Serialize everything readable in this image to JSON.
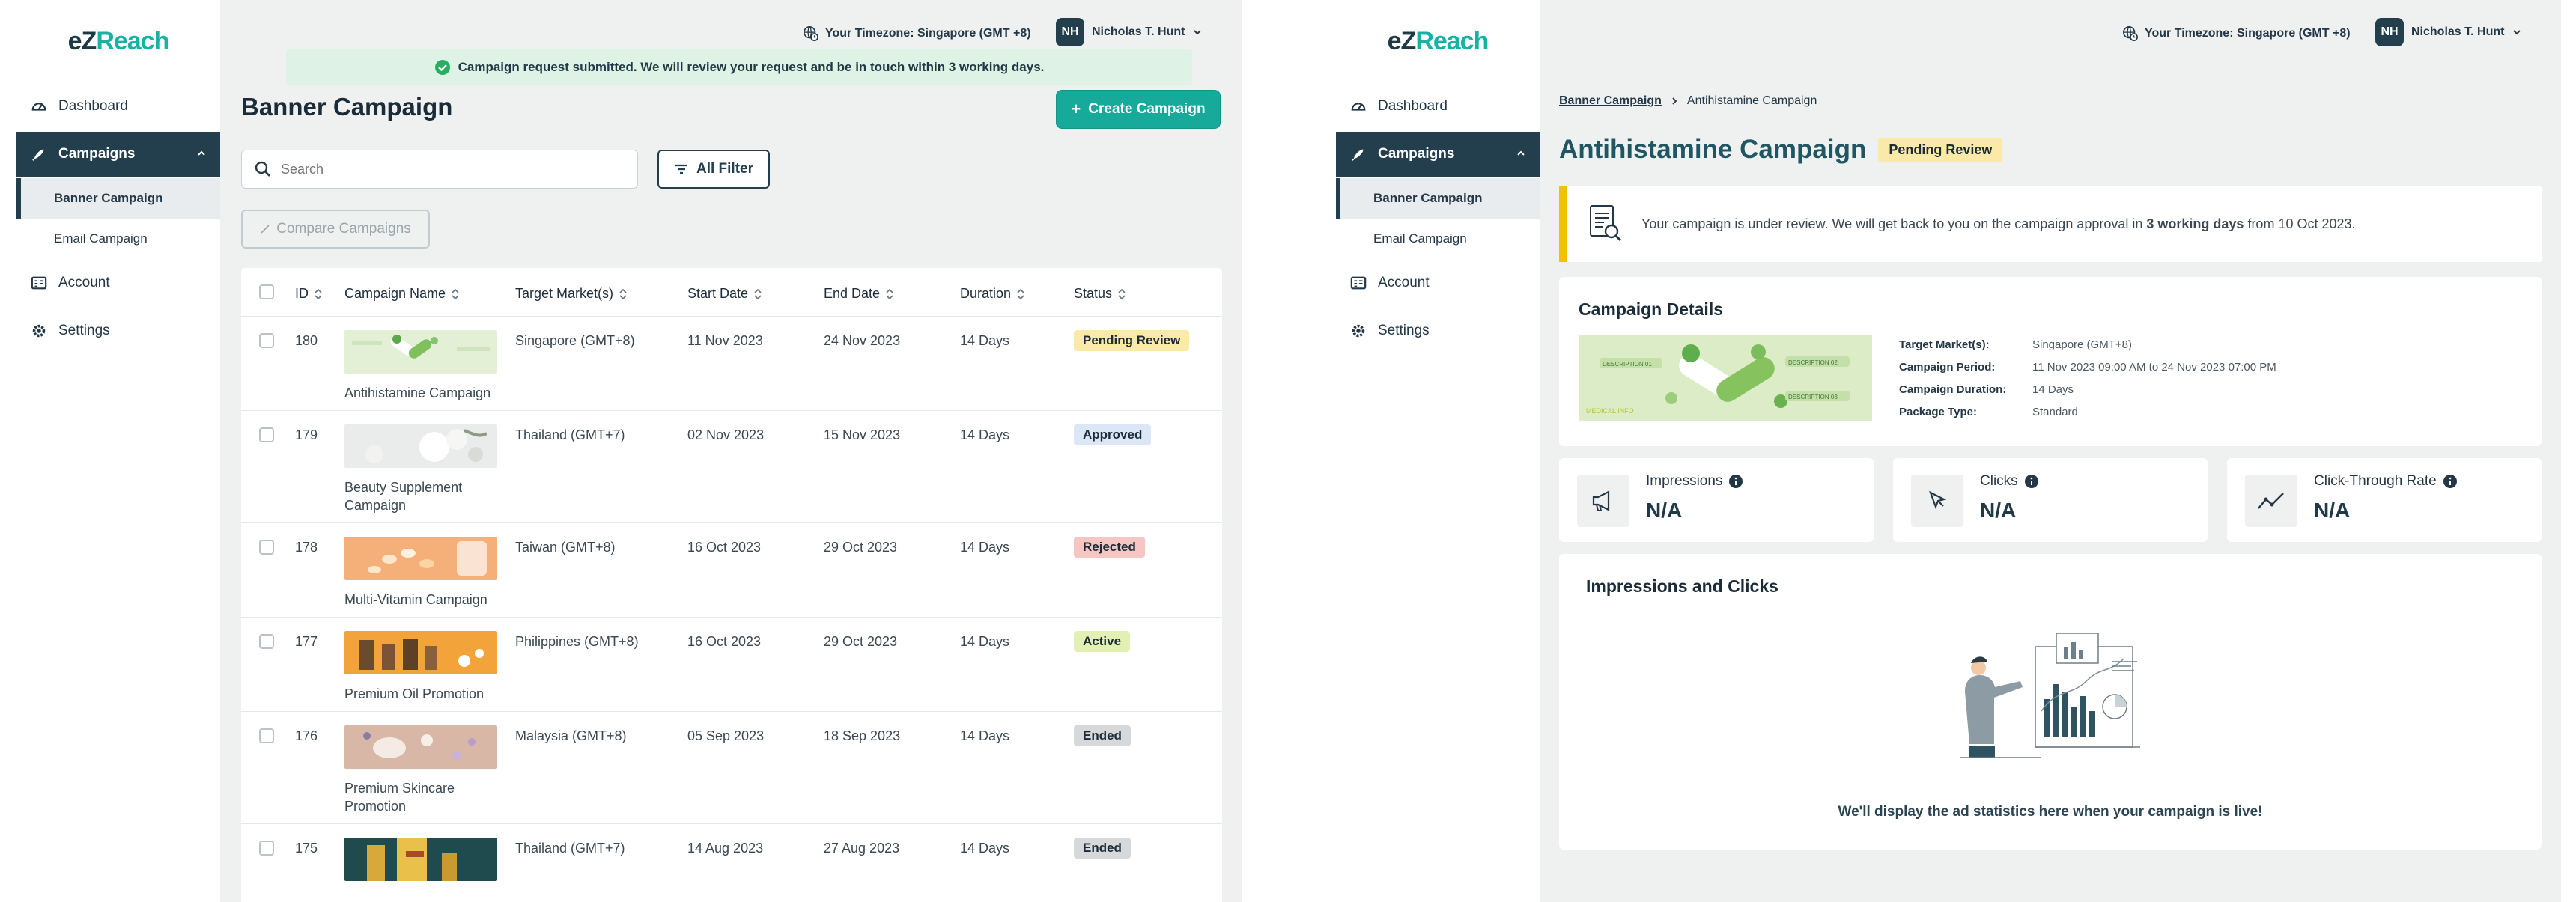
{
  "brand": {
    "logo_part1": "eZ",
    "logo_part2": "Reach"
  },
  "topbar": {
    "timezone": "Your Timezone: Singapore (GMT +8)",
    "user_initials": "NH",
    "user_name": "Nicholas T. Hunt"
  },
  "sidebar": {
    "items": [
      {
        "label": "Dashboard",
        "icon": "dashboard-icon"
      },
      {
        "label": "Campaigns",
        "icon": "rocket-icon"
      },
      {
        "label": "Account",
        "icon": "account-icon"
      },
      {
        "label": "Settings",
        "icon": "gear-icon"
      }
    ],
    "sub_items": [
      {
        "label": "Banner Campaign"
      },
      {
        "label": "Email Campaign"
      }
    ]
  },
  "list_page": {
    "toast": "Campaign request submitted. We will review your request and be in touch within 3 working days.",
    "title": "Banner Campaign",
    "create_button": "Create Campaign",
    "search_placeholder": "Search",
    "filter_button": "All Filter",
    "compare_button": "Compare Campaigns",
    "columns": [
      "ID",
      "Campaign Name",
      "Target Market(s)",
      "Start Date",
      "End Date",
      "Duration",
      "Status"
    ],
    "rows": [
      {
        "id": "180",
        "name": "Antihistamine Campaign",
        "market": "Singapore (GMT+8)",
        "start": "11 Nov 2023",
        "end": "24 Nov 2023",
        "duration": "14 Days",
        "status": "Pending Review",
        "status_color": "#fbe9a8"
      },
      {
        "id": "179",
        "name": "Beauty Supplement Campaign",
        "market": "Thailand (GMT+7)",
        "start": "02 Nov 2023",
        "end": "15 Nov 2023",
        "duration": "14 Days",
        "status": "Approved",
        "status_color": "#dbe6f6"
      },
      {
        "id": "178",
        "name": "Multi-Vitamin Campaign",
        "market": "Taiwan (GMT+8)",
        "start": "16 Oct 2023",
        "end": "29 Oct 2023",
        "duration": "14 Days",
        "status": "Rejected",
        "status_color": "#f6c6c2"
      },
      {
        "id": "177",
        "name": "Premium Oil Promotion",
        "market": "Philippines (GMT+8)",
        "start": "16 Oct 2023",
        "end": "29 Oct 2023",
        "duration": "14 Days",
        "status": "Active",
        "status_color": "#e3f0b4"
      },
      {
        "id": "176",
        "name": "Premium Skincare Promotion",
        "market": "Malaysia (GMT+8)",
        "start": "05 Sep 2023",
        "end": "18 Sep 2023",
        "duration": "14 Days",
        "status": "Ended",
        "status_color": "#d6d8da"
      },
      {
        "id": "175",
        "name": "",
        "market": "Thailand (GMT+7)",
        "start": "14 Aug 2023",
        "end": "27 Aug 2023",
        "duration": "14 Days",
        "status": "Ended",
        "status_color": "#d6d8da"
      }
    ]
  },
  "detail_page": {
    "breadcrumb_root": "Banner Campaign",
    "breadcrumb_current": "Antihistamine Campaign",
    "title": "Antihistamine Campaign",
    "status": "Pending Review",
    "notice_pre": "Your campaign is under review. We will get back to you on the campaign approval in ",
    "notice_bold": "3 working days",
    "notice_post": " from 10 Oct 2023.",
    "details_title": "Campaign Details",
    "banner_text_1": "DESCRIPTION 01",
    "banner_text_2": "DESCRIPTION 02",
    "banner_text_3": "DESCRIPTION 03",
    "banner_logo": "MEDICAL INFO",
    "details": [
      {
        "label": "Target Market(s):",
        "value": "Singapore (GMT+8)"
      },
      {
        "label": "Campaign Period:",
        "value": "11 Nov 2023 09:00 AM to 24 Nov 2023 07:00 PM"
      },
      {
        "label": "Campaign Duration:",
        "value": "14 Days"
      },
      {
        "label": "Package Type:",
        "value": "Standard"
      }
    ],
    "stats": [
      {
        "label": "Impressions",
        "value": "N/A",
        "icon": "megaphone-icon"
      },
      {
        "label": "Clicks",
        "value": "N/A",
        "icon": "cursor-icon"
      },
      {
        "label": "Click-Through Rate",
        "value": "N/A",
        "icon": "trend-icon"
      }
    ],
    "chart_title": "Impressions and Clicks",
    "empty_message": "We'll display the ad statistics here when your campaign is live!"
  }
}
